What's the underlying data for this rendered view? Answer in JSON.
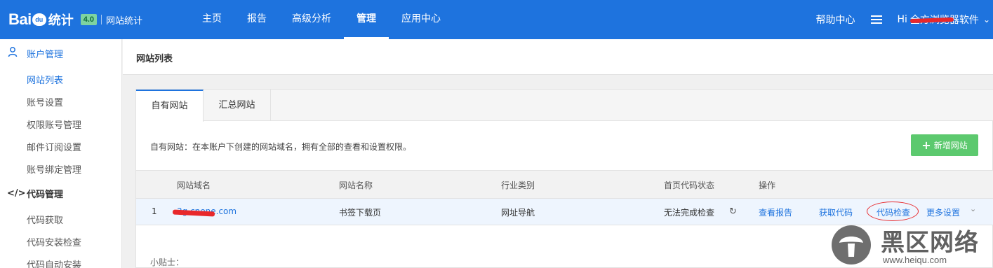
{
  "header": {
    "logo_text": "Bai",
    "logo_paw": "du",
    "logo_suffix": "统计",
    "version_badge": "4.0",
    "logo_subtitle": "网站统计",
    "nav": [
      {
        "label": "主页"
      },
      {
        "label": "报告"
      },
      {
        "label": "高级分析"
      },
      {
        "label": "管理",
        "active": true
      },
      {
        "label": "应用中心"
      }
    ],
    "help_label": "帮助中心",
    "greeting": "Hi",
    "user_name": "全方浏览器软件",
    "colors": {
      "topbar": "#1e73de",
      "badge": "#7ed3a0"
    }
  },
  "sidebar": {
    "account_group": {
      "label": "账户管理",
      "icon": "person-icon"
    },
    "account_items": [
      {
        "label": "网站列表",
        "active": true
      },
      {
        "label": "账号设置"
      },
      {
        "label": "权限账号管理"
      },
      {
        "label": "邮件订阅设置"
      },
      {
        "label": "账号绑定管理"
      }
    ],
    "code_group": {
      "label": "代码管理",
      "icon": "code-icon",
      "icon_glyph": "</>"
    },
    "code_items": [
      {
        "label": "代码获取"
      },
      {
        "label": "代码安装检查"
      },
      {
        "label": "代码自动安装"
      }
    ]
  },
  "main": {
    "page_title": "网站列表",
    "tabs": [
      {
        "label": "自有网站",
        "active": true
      },
      {
        "label": "汇总网站"
      }
    ],
    "description": "自有网站：在本账户下创建的网站域名，拥有全部的查看和设置权限。",
    "add_button": {
      "icon": "plus-icon",
      "glyph": "+",
      "label": "新增网站",
      "color": "#5cc96e"
    },
    "table": {
      "headers": [
        "网站域名",
        "网站名称",
        "行业类别",
        "首页代码状态",
        "操作"
      ],
      "rows": [
        {
          "index": "1",
          "domain": "3g.cnene.com",
          "name": "书签下载页",
          "industry": "网址导航",
          "status": "无法完成检查",
          "refresh_glyph": "↻",
          "actions": [
            "查看报告",
            "获取代码",
            "代码检查",
            "更多设置"
          ],
          "more_glyph": "⌄"
        }
      ]
    },
    "tips_label": "小贴士："
  },
  "watermark": {
    "title": "黑区网络",
    "url": "www.heiqu.com"
  }
}
